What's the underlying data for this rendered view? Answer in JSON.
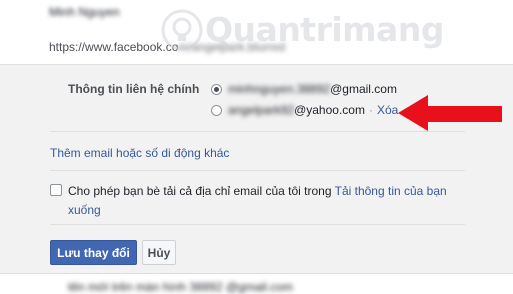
{
  "profile": {
    "name": "Minh Nguyen",
    "url_prefix": "https://www.facebook.co",
    "url_rest": "m/angelpark.blurred"
  },
  "contact": {
    "label": "Thông tin liên hệ chính",
    "primary_email_hidden": "minhnguyen.38892",
    "primary_email_domain": "@gmail.com",
    "secondary_email_hidden": "angelpark92",
    "secondary_email_domain": "@yahoo.com",
    "separator": "·",
    "remove_label": "Xóa"
  },
  "add_email_link": "Thêm email hoặc số di động khác",
  "download_permission": {
    "text": "Cho phép bạn bè tải cả địa chỉ email của tôi trong ",
    "link": "Tải thông tin của bạn xuống"
  },
  "buttons": {
    "save_label": "Lưu thay đổi",
    "cancel_label": "Hủy"
  },
  "footer_text": "tên mới trên màn hình 38892 @gmail.com",
  "watermark": {
    "text": "Quantrimang"
  },
  "colors": {
    "link": "#365899",
    "primary_button": "#4267b2",
    "arrow": "#e8101b",
    "panel_bg": "#f2f2f2"
  }
}
